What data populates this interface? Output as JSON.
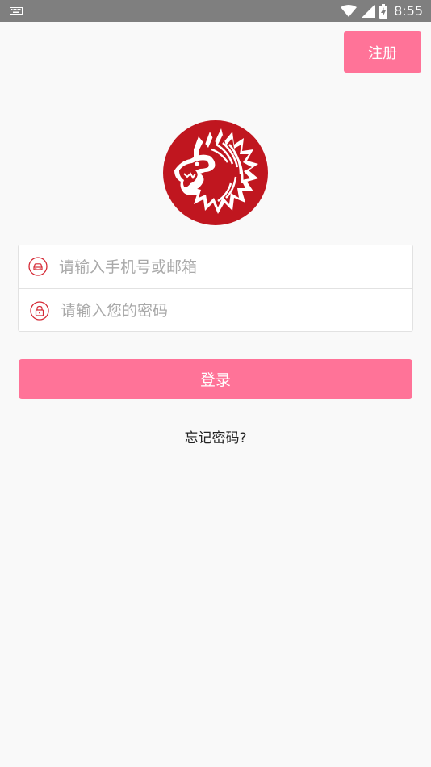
{
  "status_bar": {
    "time": "8:55",
    "icons": [
      "keyboard-icon",
      "wifi-icon",
      "signal-icon",
      "battery-charging-icon"
    ]
  },
  "header": {
    "register_label": "注册"
  },
  "logo": {
    "icon": "lion-logo-icon",
    "color": "#c0161f"
  },
  "form": {
    "phone": {
      "placeholder": "请输入手机号或邮箱",
      "value": "",
      "icon": "car-icon"
    },
    "password": {
      "placeholder": "请输入您的密码",
      "value": "",
      "icon": "lock-icon"
    }
  },
  "login_label": "登录",
  "forgot_label": "忘记密码?",
  "colors": {
    "accent": "#ff7398",
    "icon_red": "#d52a36",
    "status_bar": "#7f7f7f",
    "background": "#f9f9f9"
  }
}
